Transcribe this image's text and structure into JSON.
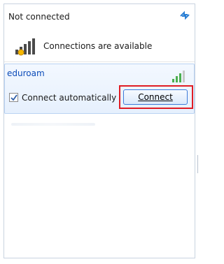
{
  "header": {
    "title": "Not connected",
    "refresh_icon": "refresh-icon"
  },
  "status": {
    "text": "Connections are available",
    "icon": "wireless-signal-icon"
  },
  "network": {
    "ssid": "eduroam",
    "signal_icon": "signal-strength-icon",
    "auto_connect_label": "Connect automatically",
    "auto_connect_checked": true,
    "connect_label": "Connect"
  },
  "colors": {
    "accent": "#0b4bb8",
    "highlight": "#e01c24",
    "selection": "#e6f0fd"
  }
}
